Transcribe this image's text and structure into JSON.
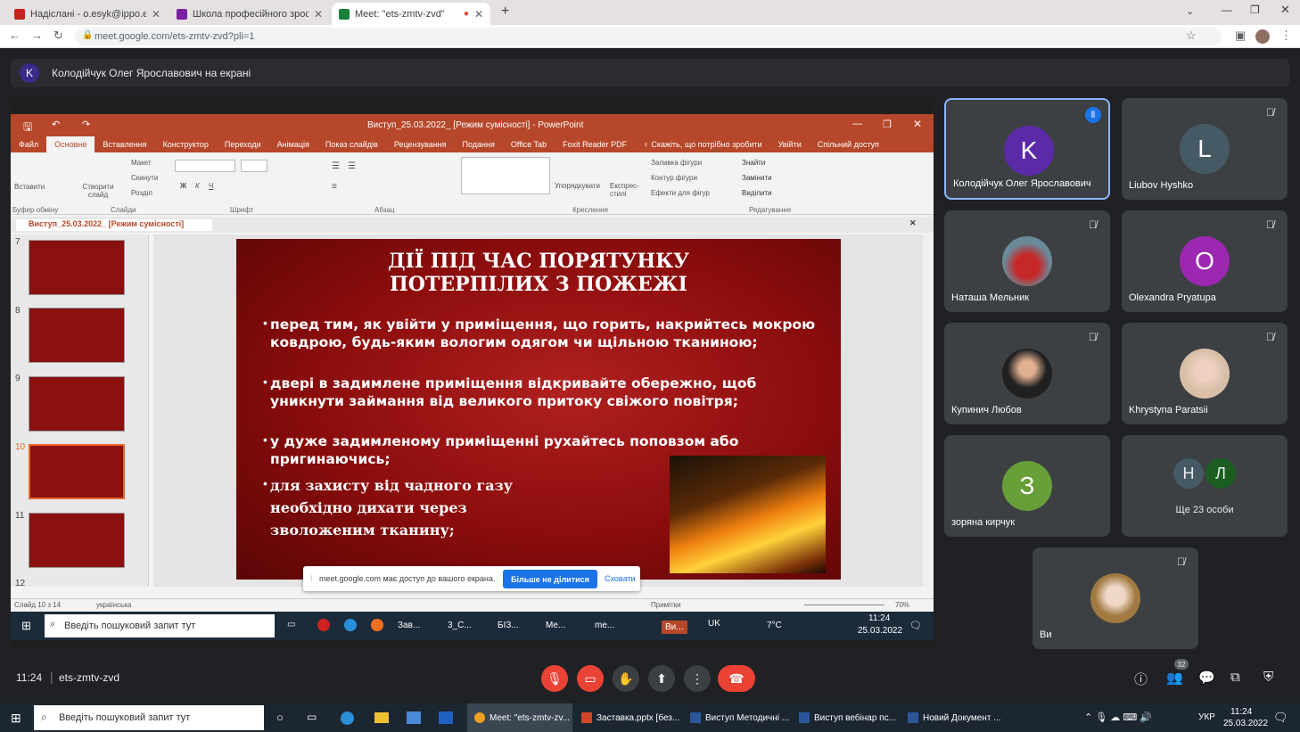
{
  "browser": {
    "tabs": [
      {
        "label": "Надіслані - o.esyk@ippo.edu.ua",
        "color": "#c5221f"
      },
      {
        "label": "Школа професійного зростання",
        "color": "#7b1fa2"
      },
      {
        "label": "Meet: \"ets-zmtv-zvd\"",
        "color": "#188038"
      }
    ],
    "url": "meet.google.com/ets-zmtv-zvd?pli=1"
  },
  "banner": {
    "initial": "K",
    "text": "Колодійчук Олег Ярославович на екрані"
  },
  "ppt": {
    "window_title": "Виступ_25.03.2022_ [Режим сумісності] - PowerPoint",
    "tabs": [
      "Файл",
      "Основне",
      "Вставлення",
      "Конструктор",
      "Переходи",
      "Анімація",
      "Показ слайдів",
      "Рецензування",
      "Подання",
      "Office Tab",
      "Foxit Reader PDF",
      "♀ Скажіть, що потрібно зробити",
      "Увійти",
      "Спільний доступ"
    ],
    "ribbon_groups": [
      "Буфер обміну",
      "Слайди",
      "Шрифт",
      "Абзац",
      "Креслення",
      "Редагування"
    ],
    "ribbon_items": {
      "paste": "Вставити",
      "create": "Створити слайд",
      "layout": "Макет",
      "reset": "Скинути",
      "section": "Розділ",
      "arrange": "Упорядкувати",
      "styles": "Експрес-стилі",
      "fill": "Заливка фігури",
      "outline": "Контур фігури",
      "effects": "Ефекти для фігур",
      "find": "Знайти",
      "replace": "Замінити",
      "select": "Виділити"
    },
    "doc_tab": "Виступ_25.03.2022_ [Режим сумісності]",
    "thumbs": [
      "7",
      "8",
      "9",
      "10",
      "11",
      "12"
    ],
    "status_slide": "Слайд 10 з 14",
    "status_lang": "українська",
    "status_notes": "Примітки",
    "zoom": "70%"
  },
  "slide": {
    "title1": "ДІЇ ПІД ЧАС ПОРЯТУНКУ",
    "title2": "ПОТЕРПІЛИХ З ПОЖЕЖІ",
    "b1": "перед тим, як увійти у приміщення, що горить, накрийтесь мокрою ковдрою, будь-яким вологим одягом чи щільною тканиною;",
    "b2": "двері в задимлене приміщення відкривайте обережно, щоб уникнути займання від великого притоку свіжого повітря;",
    "b3": "у дуже задимленому приміщенні рухайтесь поповзом або пригинаючись;",
    "b4a": "для захисту від чадного газу",
    "b4b": "необхідно дихати через",
    "b4c": "зволоженим тканину;"
  },
  "share_notice": {
    "text": "meet.google.com має доступ до вашого екрана.",
    "stop": "Більше не ділитися",
    "hide": "Сховати"
  },
  "inner_taskbar": {
    "search": "Введіть пошуковий запит тут",
    "apps": [
      "Зав...",
      "3_С...",
      "БІЗ...",
      "Me...",
      "me...",
      "Ви..."
    ],
    "lang": "UK",
    "temp": "7°C",
    "time": "11:24",
    "date": "25.03.2022",
    "badge": "3"
  },
  "participants": [
    {
      "name": "Колодійчук Олег Ярославович",
      "initial": "K",
      "color": "#5b2aa8",
      "active": true
    },
    {
      "name": "Liubov Hyshko",
      "initial": "L",
      "color": "#455a64"
    },
    {
      "name": "Наташа Мельник",
      "initial": "",
      "color": "#c62828"
    },
    {
      "name": "Olexandra Pryatupa",
      "initial": "O",
      "color": "#9c27b0"
    },
    {
      "name": "Купинич Любов",
      "initial": "",
      "color": "#303030"
    },
    {
      "name": "Khrystyna Paratsii",
      "initial": "",
      "color": "#c9b8a8"
    },
    {
      "name": "зоряна кирчук",
      "initial": "З",
      "color": "#689f38"
    },
    {
      "name": "Ще 23 особи",
      "initial": "",
      "color": ""
    },
    {
      "name": "Ви",
      "initial": "",
      "color": "#a07a40"
    }
  ],
  "more_avatars": [
    "Н",
    "Л"
  ],
  "meet_bar": {
    "time": "11:24",
    "code": "ets-zmtv-zvd",
    "people_count": "32"
  },
  "taskbar": {
    "search": "Введіть пошуковий запит тут",
    "apps": [
      "Meet: \"ets-zmtv-zv...",
      "Заставка.pptx [без...",
      "Виступ Методичні ...",
      "Виступ вебінар пс...",
      "Новий Документ ..."
    ],
    "lang": "УКР",
    "time": "11:24",
    "date": "25.03.2022"
  }
}
